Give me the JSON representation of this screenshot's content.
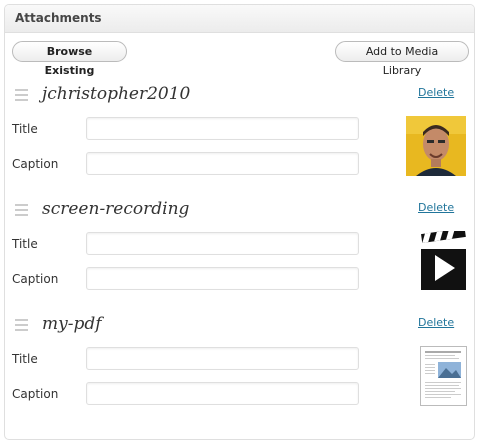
{
  "panel": {
    "title": "Attachments"
  },
  "toolbar": {
    "browse_label": "Browse Existing",
    "add_label": "Add to Media Library"
  },
  "attachments": [
    {
      "name": "jchristopher2010",
      "delete_label": "Delete",
      "title_label": "Title",
      "caption_label": "Caption",
      "title_value": "",
      "caption_value": "",
      "thumb": "photo"
    },
    {
      "name": "screen-recording",
      "delete_label": "Delete",
      "title_label": "Title",
      "caption_label": "Caption",
      "title_value": "",
      "caption_value": "",
      "thumb": "video-icon"
    },
    {
      "name": "my-pdf",
      "delete_label": "Delete",
      "title_label": "Title",
      "caption_label": "Caption",
      "title_value": "",
      "caption_value": "",
      "thumb": "pdf-document-icon"
    }
  ],
  "colors": {
    "link": "#21759b",
    "border": "#dfdfdf"
  }
}
